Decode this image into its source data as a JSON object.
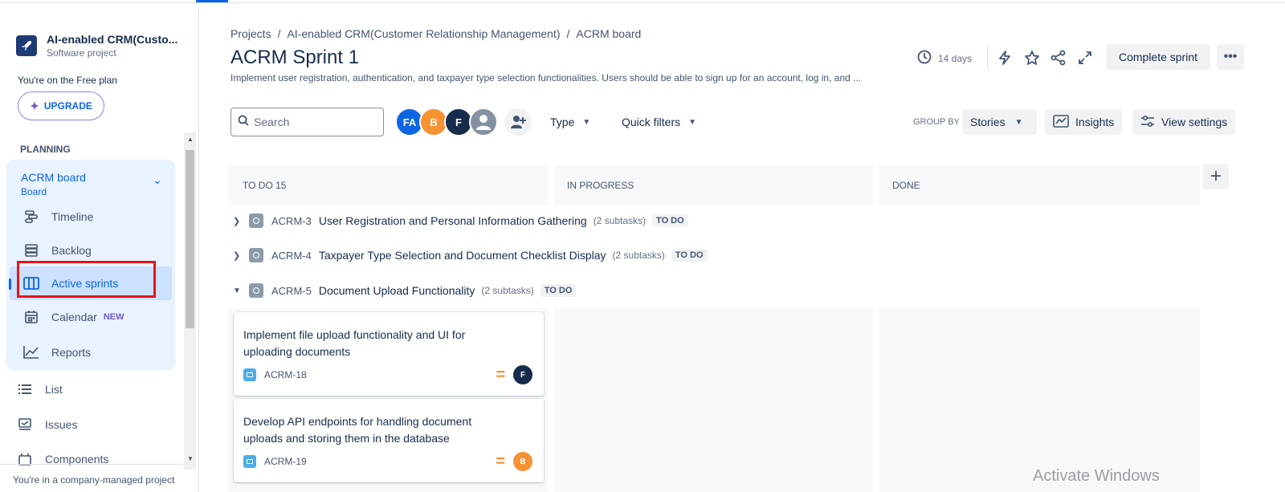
{
  "sidebar": {
    "project_name": "AI-enabled CRM(Custo...",
    "project_type": "Software project",
    "plan_text": "You're on the Free plan",
    "upgrade_label": "UPGRADE",
    "planning_label": "PLANNING",
    "board": {
      "name": "ACRM board",
      "sub": "Board"
    },
    "items": [
      {
        "label": "Timeline",
        "icon": "timeline-icon"
      },
      {
        "label": "Backlog",
        "icon": "backlog-icon"
      },
      {
        "label": "Active sprints",
        "icon": "board-columns-icon"
      },
      {
        "label": "Calendar",
        "icon": "calendar-icon",
        "badge": "NEW"
      },
      {
        "label": "Reports",
        "icon": "chart-icon"
      },
      {
        "label": "List",
        "icon": "list-icon"
      },
      {
        "label": "Issues",
        "icon": "issues-icon"
      },
      {
        "label": "Components",
        "icon": "components-icon"
      }
    ],
    "footer": "You're in a company-managed project"
  },
  "header": {
    "breadcrumb": [
      "Projects",
      "AI-enabled CRM(Customer Relationship Management)",
      "ACRM board"
    ],
    "title": "ACRM Sprint 1",
    "description": "Implement user registration, authentication, and taxpayer type selection functionalities. Users should be able to sign up for an account, log in, and ...",
    "days": "14 days",
    "complete_label": "Complete sprint"
  },
  "toolbar": {
    "search_placeholder": "Search",
    "avatars": [
      {
        "initials": "FA",
        "color": "#0c66e4"
      },
      {
        "initials": "B",
        "color": "#f79232"
      },
      {
        "initials": "F",
        "color": "#172b4d"
      },
      {
        "initials": "",
        "color": "#8590a2"
      }
    ],
    "type_label": "Type",
    "quick_filters_label": "Quick filters",
    "group_by_label": "GROUP BY",
    "group_by_value": "Stories",
    "insights_label": "Insights",
    "view_settings_label": "View settings"
  },
  "columns": [
    {
      "label": "TO DO 15"
    },
    {
      "label": "IN PROGRESS"
    },
    {
      "label": "DONE"
    }
  ],
  "stories": [
    {
      "key": "ACRM-3",
      "summary": "User Registration and Personal Information Gathering",
      "subtasks": "(2 subtasks)",
      "status": "TO DO",
      "expanded": false
    },
    {
      "key": "ACRM-4",
      "summary": "Taxpayer Type Selection and Document Checklist Display",
      "subtasks": "(2 subtasks)",
      "status": "TO DO",
      "expanded": false
    },
    {
      "key": "ACRM-5",
      "summary": "Document Upload Functionality",
      "subtasks": "(2 subtasks)",
      "status": "TO DO",
      "expanded": true
    }
  ],
  "cards": [
    {
      "text": "Implement file upload functionality and UI for uploading documents",
      "key": "ACRM-18",
      "assignee": "F",
      "assignee_color": "#172b4d"
    },
    {
      "text": "Develop API endpoints for handling document uploads and storing them in the database",
      "key": "ACRM-19",
      "assignee": "B",
      "assignee_color": "#f79232"
    }
  ],
  "watermark": "Activate Windows",
  "colors": {
    "accent": "#0c66e4",
    "highlight": "#e5141a"
  }
}
